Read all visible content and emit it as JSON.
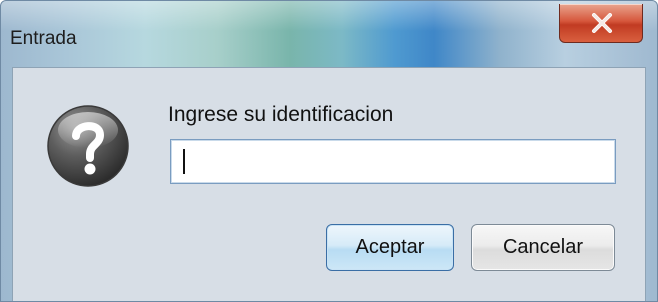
{
  "window": {
    "title": "Entrada"
  },
  "icons": {
    "close": "close-icon",
    "question": "question-icon"
  },
  "dialog": {
    "prompt": "Ingrese su identificacion",
    "input": {
      "value": "",
      "placeholder": ""
    },
    "buttons": {
      "accept_label": "Aceptar",
      "cancel_label": "Cancelar"
    }
  },
  "colors": {
    "close_button": "#c13b22",
    "accept_border": "#3a6ea5",
    "content_background": "#d7dee6"
  }
}
